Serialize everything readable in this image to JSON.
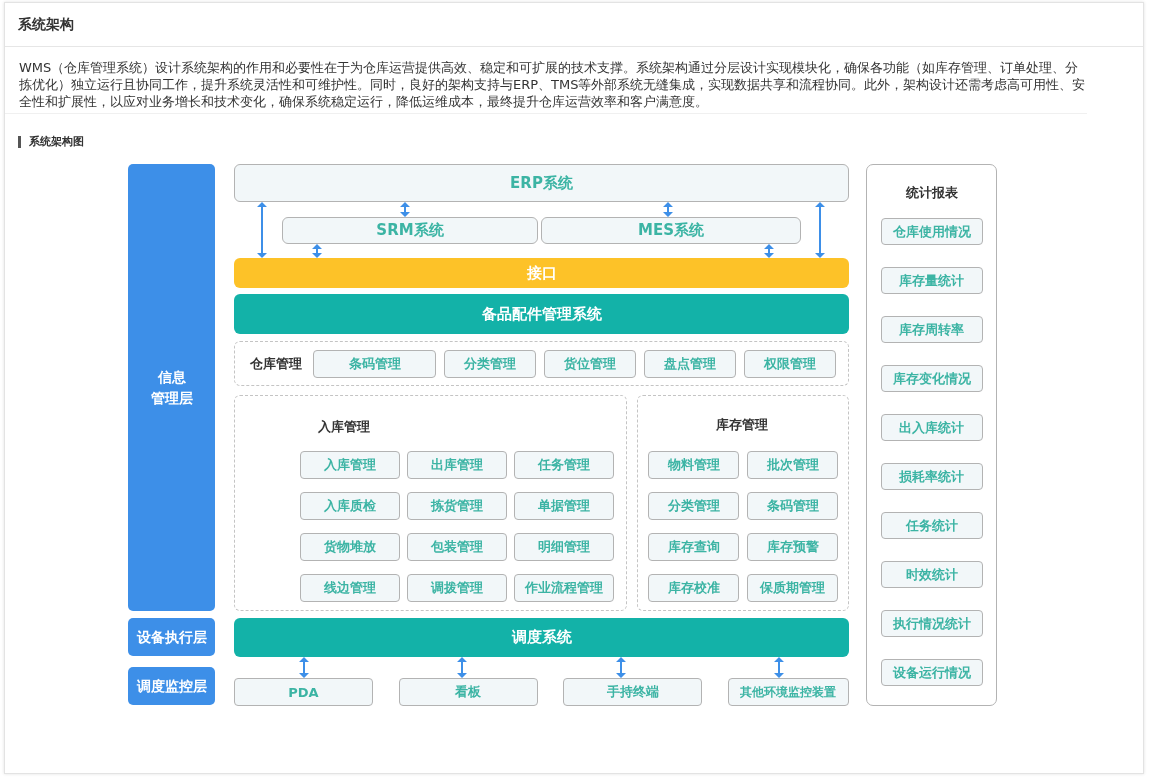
{
  "page": {
    "title": "系统架构"
  },
  "description": "WMS（仓库管理系统）设计系统架构的作用和必要性在于为仓库运营提供高效、稳定和可扩展的技术支撑。系统架构通过分层设计实现模块化，确保各功能（如库存管理、订单处理、分拣优化）独立运行且协同工作，提升系统灵活性和可维护性。同时，良好的架构支持与ERP、TMS等外部系统无缝集成，实现数据共享和流程协同。此外，架构设计还需考虑高可用性、安全性和扩展性，以应对业务增长和技术变化，确保系统稳定运行，降低运维成本，最终提升仓库运营效率和客户满意度。",
  "section_title": "系统架构图",
  "diagram": {
    "layers": [
      {
        "lines": [
          "信息",
          "管理层"
        ]
      },
      {
        "lines": [
          "设备执行层"
        ]
      },
      {
        "lines": [
          "调度监控层"
        ]
      }
    ],
    "erp": "ERP系统",
    "subsystems": [
      "SRM系统",
      "MES系统"
    ],
    "interface": "接口",
    "core": "备品配件管理系统",
    "warehouse": {
      "title": "仓库管理",
      "items": [
        "条码管理",
        "分类管理",
        "货位管理",
        "盘点管理",
        "权限管理"
      ]
    },
    "inbound": {
      "title": "入库管理",
      "items": [
        "入库管理",
        "出库管理",
        "任务管理",
        "入库质检",
        "拣货管理",
        "单据管理",
        "货物堆放",
        "包装管理",
        "明细管理",
        "线边管理",
        "调拨管理",
        "作业流程管理"
      ]
    },
    "inventory": {
      "title": "库存管理",
      "items": [
        "物料管理",
        "批次管理",
        "分类管理",
        "条码管理",
        "库存查询",
        "库存预警",
        "库存校准",
        "保质期管理"
      ]
    },
    "dispatch": "调度系统",
    "devices": [
      "PDA",
      "看板",
      "手持终端",
      "其他环境监控装置"
    ],
    "reports": {
      "title": "统计报表",
      "items": [
        "仓库使用情况",
        "库存量统计",
        "库存周转率",
        "库存变化情况",
        "出入库统计",
        "损耗率统计",
        "任务统计",
        "时效统计",
        "执行情况统计",
        "设备运行情况"
      ]
    }
  }
}
